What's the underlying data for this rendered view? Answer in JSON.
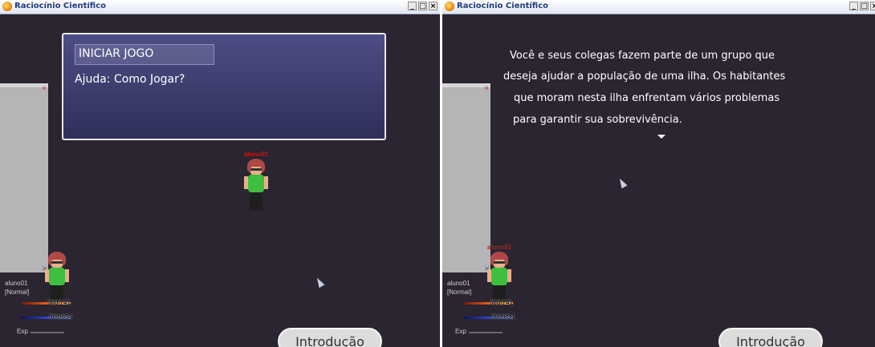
{
  "window_left": {
    "title": "Raciocínio Científico",
    "controls": {
      "minimize": "_",
      "maximize": "□",
      "close": "×"
    },
    "menu": {
      "items": [
        "INICIAR JOGO",
        "Ajuda: Como Jogar?"
      ]
    },
    "character_name": "aluno01",
    "hud": {
      "name": "aluno01",
      "status": "[Normal]",
      "hp": "580/741",
      "mp": "500/634",
      "exp_label": "Exp"
    },
    "intro_button": "Introdução"
  },
  "window_right": {
    "title": "Raciocínio Científico",
    "controls": {
      "minimize": "_",
      "maximize": "□",
      "close": "×"
    },
    "intro_lines": [
      "Você e seus colegas fazem parte de um grupo que",
      "deseja ajudar a população de uma ilha. Os habitantes",
      "que moram nesta ilha enfrentam vários problemas",
      "para garantir sua sobrevivência."
    ],
    "character_name": "aluno01",
    "hud": {
      "name": "aluno01",
      "status": "[Normal]",
      "hp": "580/741",
      "mp": "500/634",
      "exp_label": "Exp"
    },
    "intro_button": "Introdução"
  },
  "colors": {
    "background": "#2a2530",
    "dialog": "#3d3f70",
    "hp_bar": "#d84a1a",
    "mp_bar": "#2c42c8",
    "character_shirt": "#3fbf3f"
  },
  "icons": [
    "app-icon",
    "cursor-icon",
    "continue-arrow-icon"
  ]
}
